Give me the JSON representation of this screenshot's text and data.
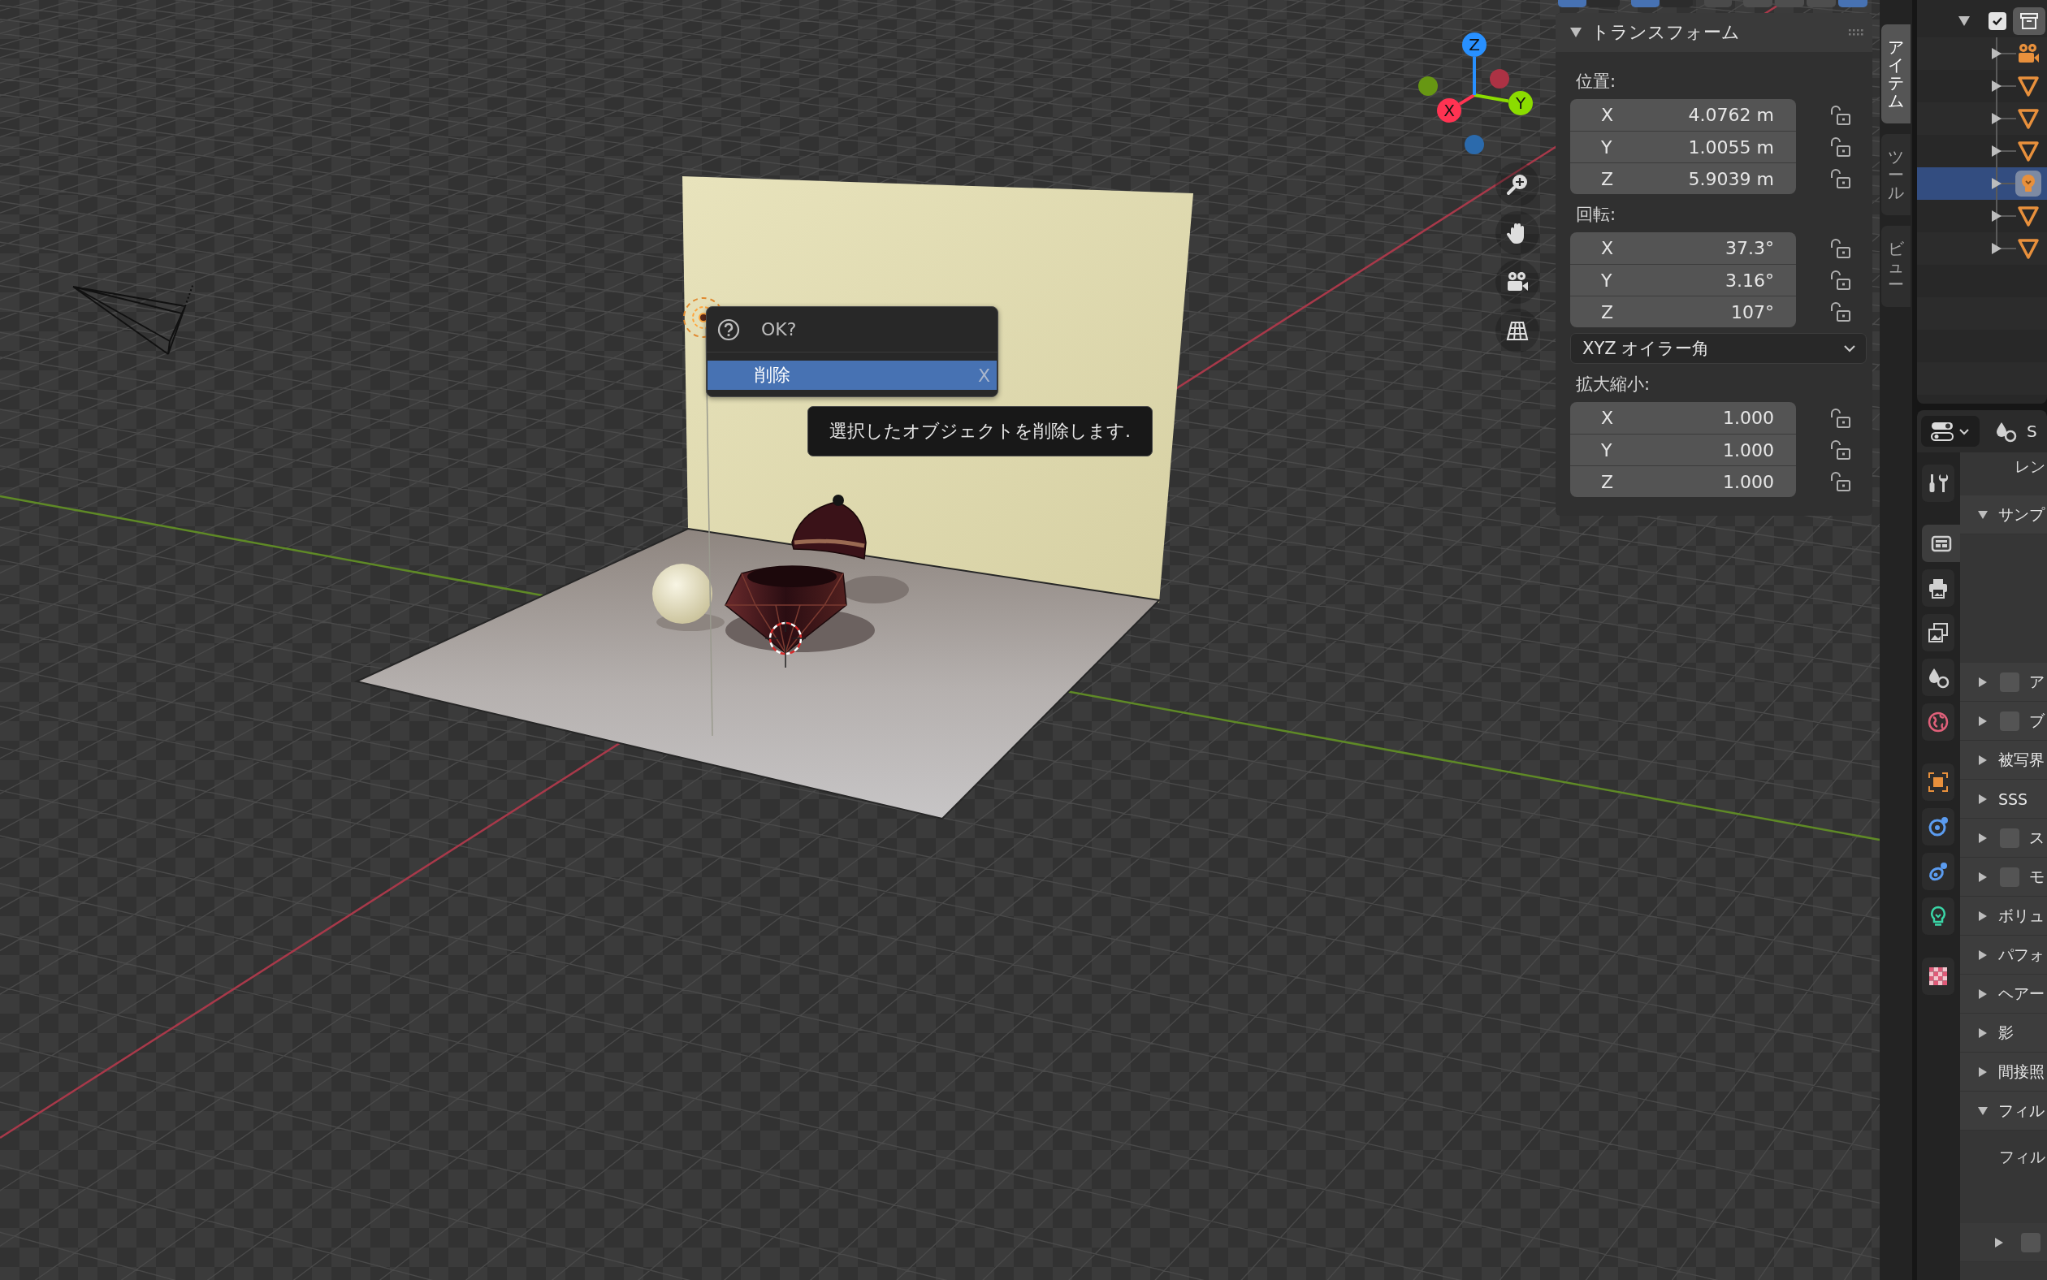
{
  "header_button_groups": [
    [
      {
        "selected": true
      },
      {
        "selected": false
      }
    ],
    [
      {
        "selected": true
      },
      {
        "selected": false
      }
    ],
    [
      {
        "selected": false
      }
    ],
    [
      {
        "selected": false
      },
      {
        "selected": false
      },
      {
        "selected": false
      },
      {
        "selected": true
      }
    ]
  ],
  "viewport": {
    "navigation_gizmo": {
      "axes": [
        {
          "label": "X",
          "color": "#ff3352"
        },
        {
          "label": "Y",
          "color": "#8bdc00"
        },
        {
          "label": "Z",
          "color": "#2890ff"
        }
      ]
    },
    "view_buttons": [
      {
        "kind": "zoom"
      },
      {
        "kind": "pan"
      },
      {
        "kind": "camera"
      },
      {
        "kind": "projection"
      }
    ]
  },
  "confirm_popup": {
    "title": "OK?",
    "items": [
      {
        "label": "削除",
        "shortcut": "X",
        "selected": true
      }
    ]
  },
  "tooltip": {
    "text": "選択したオブジェクトを削除します."
  },
  "sidebar": {
    "tabs": [
      {
        "label": "アイテム",
        "selected": true
      },
      {
        "label": "ツール",
        "selected": false
      },
      {
        "label": "ビュー",
        "selected": false
      }
    ],
    "panel": {
      "title": "トランスフォーム",
      "expanded": true,
      "sections": [
        {
          "kind": "fields",
          "label": "位置:",
          "fields": [
            {
              "axis": "X",
              "value": "4.0762 m",
              "locked": false
            },
            {
              "axis": "Y",
              "value": "1.0055 m",
              "locked": false
            },
            {
              "axis": "Z",
              "value": "5.9039 m",
              "locked": false
            }
          ]
        },
        {
          "kind": "fields",
          "label": "回転:",
          "fields": [
            {
              "axis": "X",
              "value": "37.3°",
              "locked": false
            },
            {
              "axis": "Y",
              "value": "3.16°",
              "locked": false
            },
            {
              "axis": "Z",
              "value": "107°",
              "locked": false
            }
          ]
        },
        {
          "kind": "dropdown",
          "value": "XYZ オイラー角"
        },
        {
          "kind": "fields",
          "label": "拡大縮小:",
          "fields": [
            {
              "axis": "X",
              "value": "1.000",
              "locked": false
            },
            {
              "axis": "Y",
              "value": "1.000",
              "locked": false
            },
            {
              "axis": "Z",
              "value": "1.000",
              "locked": false
            }
          ]
        }
      ]
    }
  },
  "outliner": {
    "collection": {
      "expanded": true,
      "checked": true
    },
    "objects": [
      {
        "kind": "camera",
        "expanded": false,
        "selected": false
      },
      {
        "kind": "mesh",
        "expanded": false,
        "selected": false
      },
      {
        "kind": "mesh",
        "expanded": false,
        "selected": false
      },
      {
        "kind": "mesh",
        "expanded": false,
        "selected": false
      },
      {
        "kind": "light",
        "expanded": false,
        "selected": true
      },
      {
        "kind": "mesh",
        "expanded": false,
        "selected": false
      },
      {
        "kind": "mesh",
        "expanded": false,
        "selected": false
      }
    ]
  },
  "properties": {
    "context": "S",
    "tab_groups": [
      [
        {
          "kind": "tool",
          "selected": false
        }
      ],
      [
        {
          "kind": "render",
          "selected": true
        },
        {
          "kind": "output",
          "selected": false
        },
        {
          "kind": "view_layer",
          "selected": false
        },
        {
          "kind": "scene",
          "selected": false
        },
        {
          "kind": "world",
          "selected": false
        }
      ],
      [
        {
          "kind": "object",
          "selected": false
        },
        {
          "kind": "physics",
          "selected": false
        },
        {
          "kind": "constraints",
          "selected": false
        },
        {
          "kind": "light_data",
          "selected": false
        }
      ],
      [
        {
          "kind": "texture",
          "selected": false
        }
      ]
    ],
    "rows": [
      {
        "kind": "label",
        "text": "レン"
      },
      {
        "kind": "panel",
        "label": "サンプ",
        "expanded": true
      },
      {
        "kind": "check_panel",
        "label": "ア",
        "expanded": false,
        "checked": false
      },
      {
        "kind": "check_panel",
        "label": "ブ",
        "expanded": false,
        "checked": false
      },
      {
        "kind": "panel",
        "label": "被写界",
        "expanded": false
      },
      {
        "kind": "panel",
        "label": "SSS",
        "expanded": false
      },
      {
        "kind": "check_panel",
        "label": "ス",
        "expanded": false,
        "checked": false
      },
      {
        "kind": "check_panel",
        "label": "モ",
        "expanded": false,
        "checked": false
      },
      {
        "kind": "panel",
        "label": "ボリュ",
        "expanded": false
      },
      {
        "kind": "panel",
        "label": "パフォ",
        "expanded": false
      },
      {
        "kind": "panel",
        "label": "ヘアー",
        "expanded": false
      },
      {
        "kind": "panel",
        "label": "影",
        "expanded": false
      },
      {
        "kind": "panel",
        "label": "間接照",
        "expanded": false
      },
      {
        "kind": "panel",
        "label": "フィル",
        "expanded": true
      },
      {
        "kind": "label",
        "text": "フィル"
      },
      {
        "kind": "subpanel",
        "expanded": false,
        "checked": false
      }
    ]
  }
}
